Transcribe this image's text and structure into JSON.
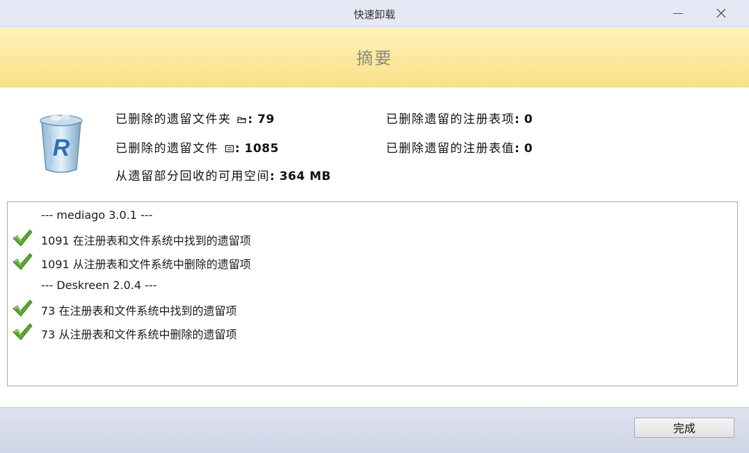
{
  "window": {
    "title": "快速卸载"
  },
  "banner": {
    "title": "摘要"
  },
  "stats": {
    "deleted_folders": {
      "label": "已删除的遗留文件夹",
      "value": ": 79"
    },
    "deleted_files": {
      "label": "已删除的遗留文件",
      "value": ": 1085"
    },
    "freed_space": {
      "label": "从遗留部分回收的可用空间",
      "value": ": 364 MB"
    },
    "deleted_reg_keys": {
      "label": "已删除遗留的注册表项",
      "value": ": 0"
    },
    "deleted_reg_values": {
      "label": "已删除遗留的注册表值",
      "value": ": 0"
    }
  },
  "log": {
    "lines": [
      {
        "text": "--- mediago 3.0.1 ---",
        "check": false
      },
      {
        "text": "1091 在注册表和文件系统中找到的遗留项",
        "check": true
      },
      {
        "text": "1091 从注册表和文件系统中删除的遗留项",
        "check": true
      },
      {
        "text": "--- Deskreen 2.0.4 ---",
        "check": false
      },
      {
        "text": "73 在注册表和文件系统中找到的遗留项",
        "check": true
      },
      {
        "text": "73 从注册表和文件系统中删除的遗留项",
        "check": true
      }
    ]
  },
  "footer": {
    "finish_label": "完成"
  },
  "icons": {
    "app": "revo-trash-bin-icon",
    "check": "green-check-icon",
    "folder": "folder-icon",
    "file": "file-icon"
  },
  "colors": {
    "banner_top": "#fdf3b8",
    "banner_bottom": "#f8e08a",
    "titlebar": "#e6e9f5",
    "footer": "#d6dae9",
    "check_green": "#5aa832"
  }
}
